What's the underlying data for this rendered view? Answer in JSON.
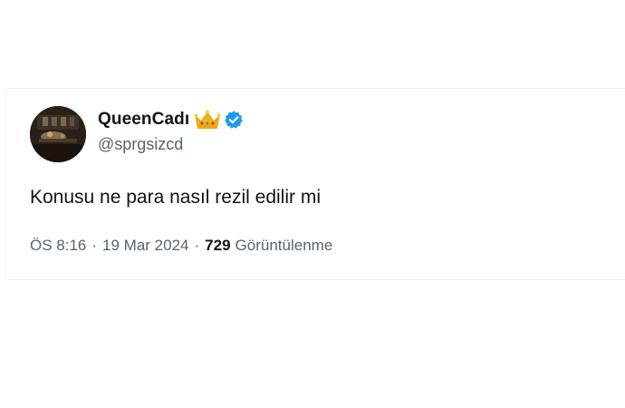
{
  "tweet": {
    "author": {
      "display_name": "QueenCadı",
      "handle": "@sprgsizcd",
      "emoji_icon": "crown-icon",
      "verified_icon": "verified-badge-icon",
      "verified_color": "#1d9bf0"
    },
    "text": "Konusu ne para nasıl rezil edilir mi",
    "meta": {
      "time": "ÖS 8:16",
      "separator": "·",
      "date": "19 Mar 2024",
      "views_count": "729",
      "views_label": "Görüntülenme"
    }
  },
  "colors": {
    "text_primary": "#0f1419",
    "text_secondary": "#536471",
    "border": "#eff3f4",
    "crown": "#f5b400"
  }
}
